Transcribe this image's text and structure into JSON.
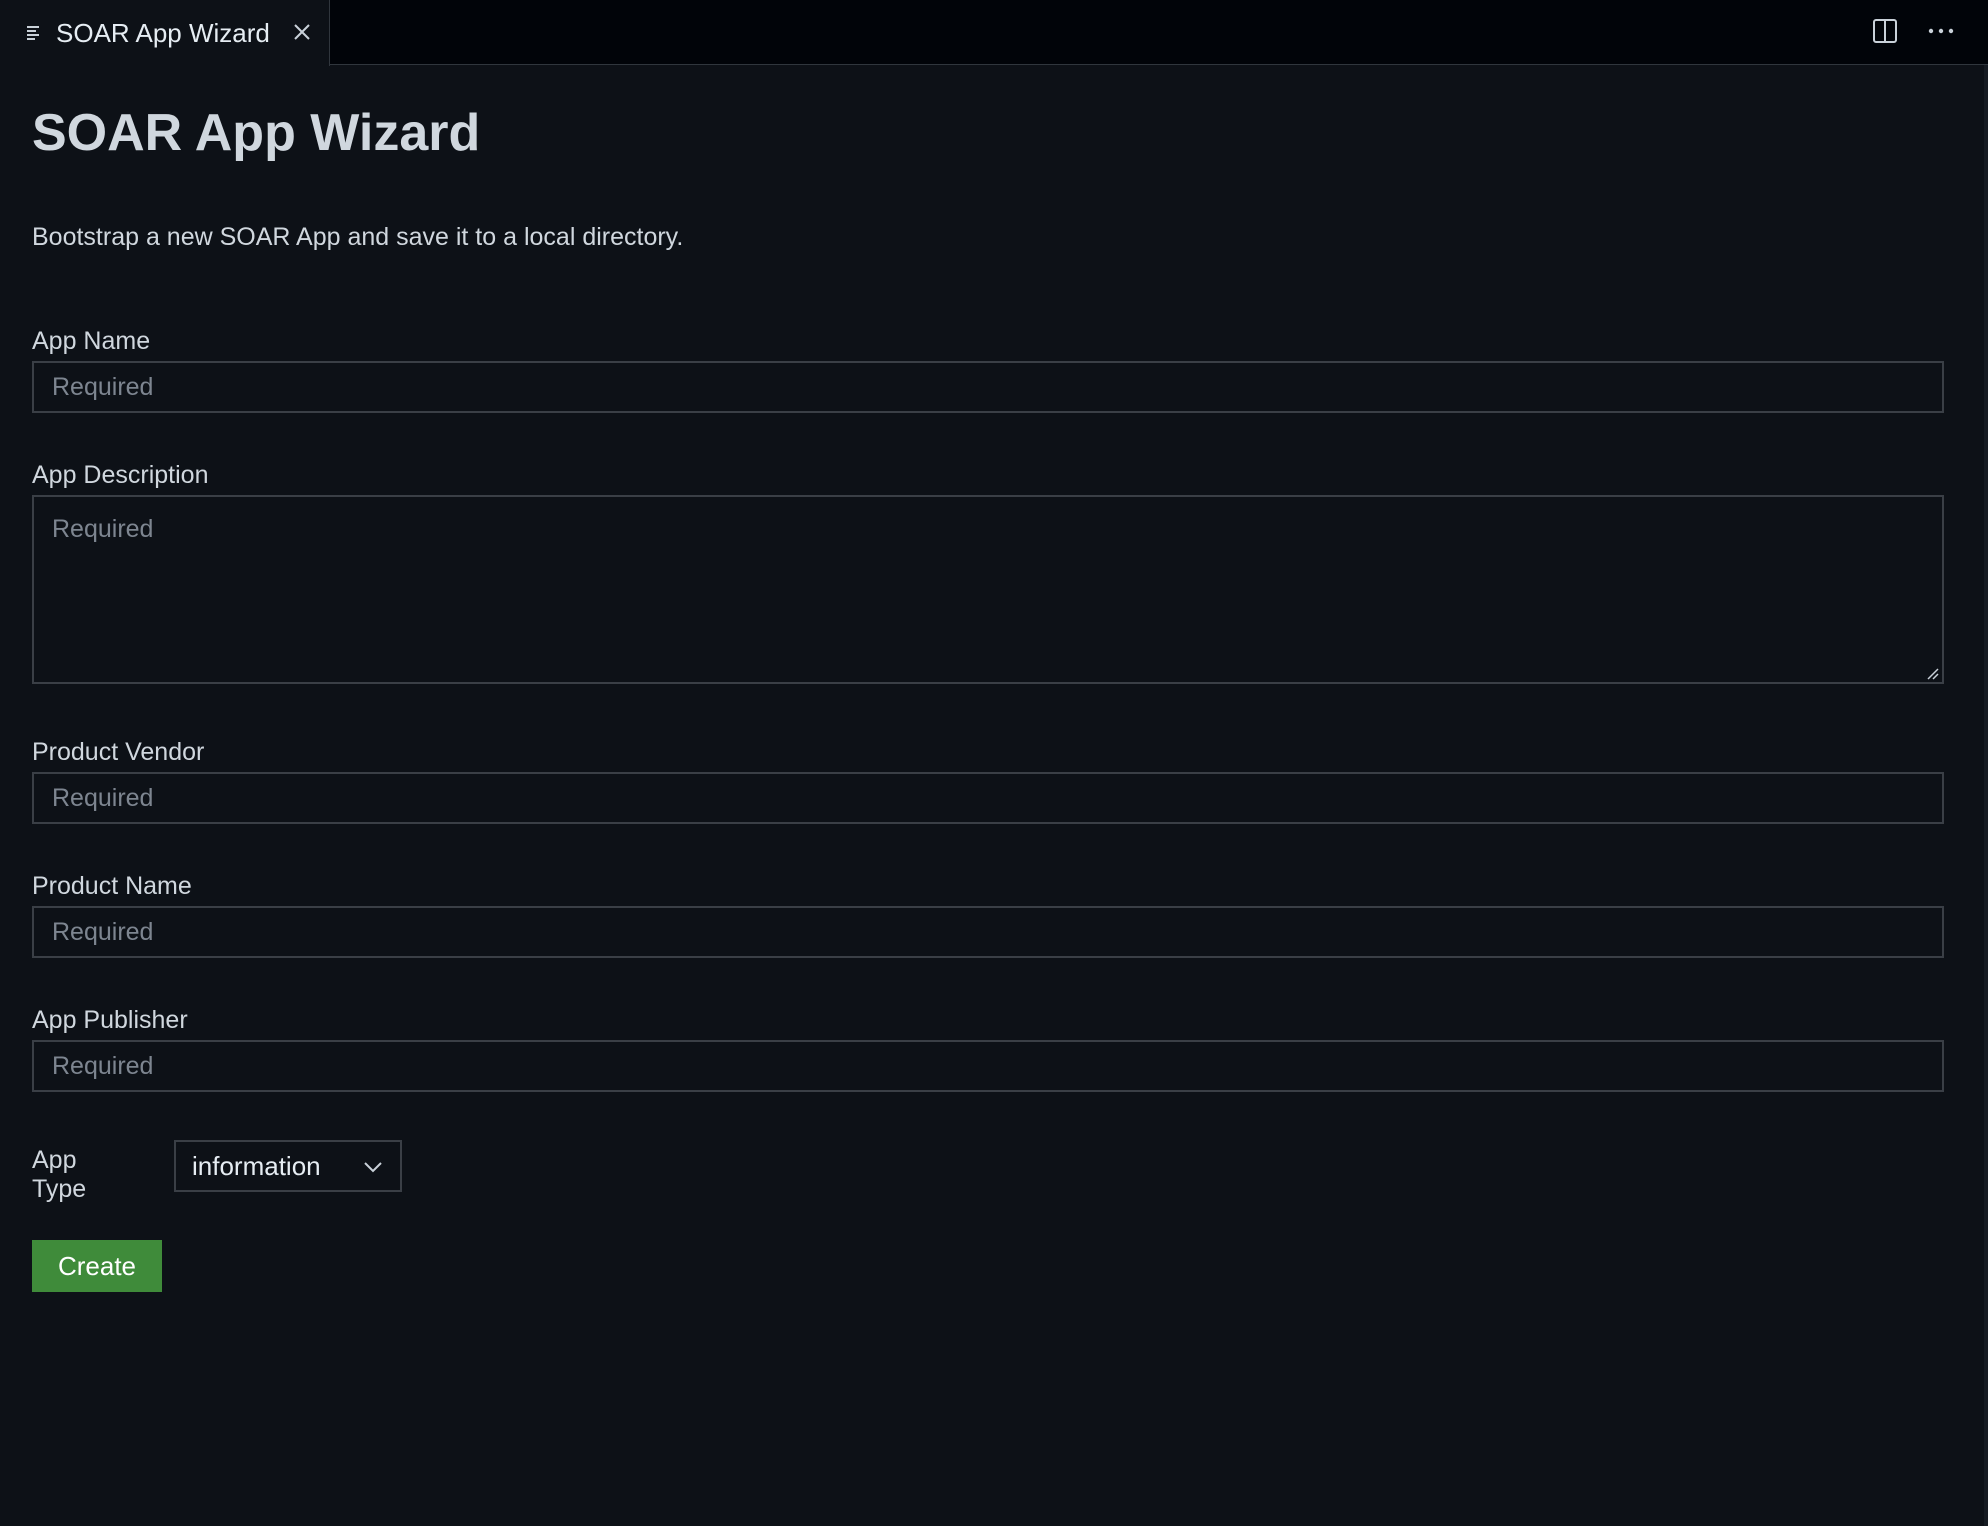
{
  "tab": {
    "title": "SOAR App Wizard",
    "icon": "preview-icon",
    "close_icon": "close-icon"
  },
  "toolbar": {
    "split_editor_icon": "split-editor-icon",
    "more_actions_icon": "more-actions-icon"
  },
  "page": {
    "title": "SOAR App Wizard",
    "description": "Bootstrap a new SOAR App and save it to a local directory."
  },
  "form": {
    "app_name": {
      "label": "App Name",
      "placeholder": "Required",
      "value": ""
    },
    "app_description": {
      "label": "App Description",
      "placeholder": "Required",
      "value": ""
    },
    "product_vendor": {
      "label": "Product Vendor",
      "placeholder": "Required",
      "value": ""
    },
    "product_name": {
      "label": "Product Name",
      "placeholder": "Required",
      "value": ""
    },
    "app_publisher": {
      "label": "App Publisher",
      "placeholder": "Required",
      "value": ""
    },
    "app_type": {
      "label": "App Type",
      "selected": "information"
    },
    "create_label": "Create"
  },
  "colors": {
    "background": "#0d1117",
    "tabbar": "#010409",
    "create_button": "#3f8b3a",
    "placeholder": "#7d8590"
  }
}
